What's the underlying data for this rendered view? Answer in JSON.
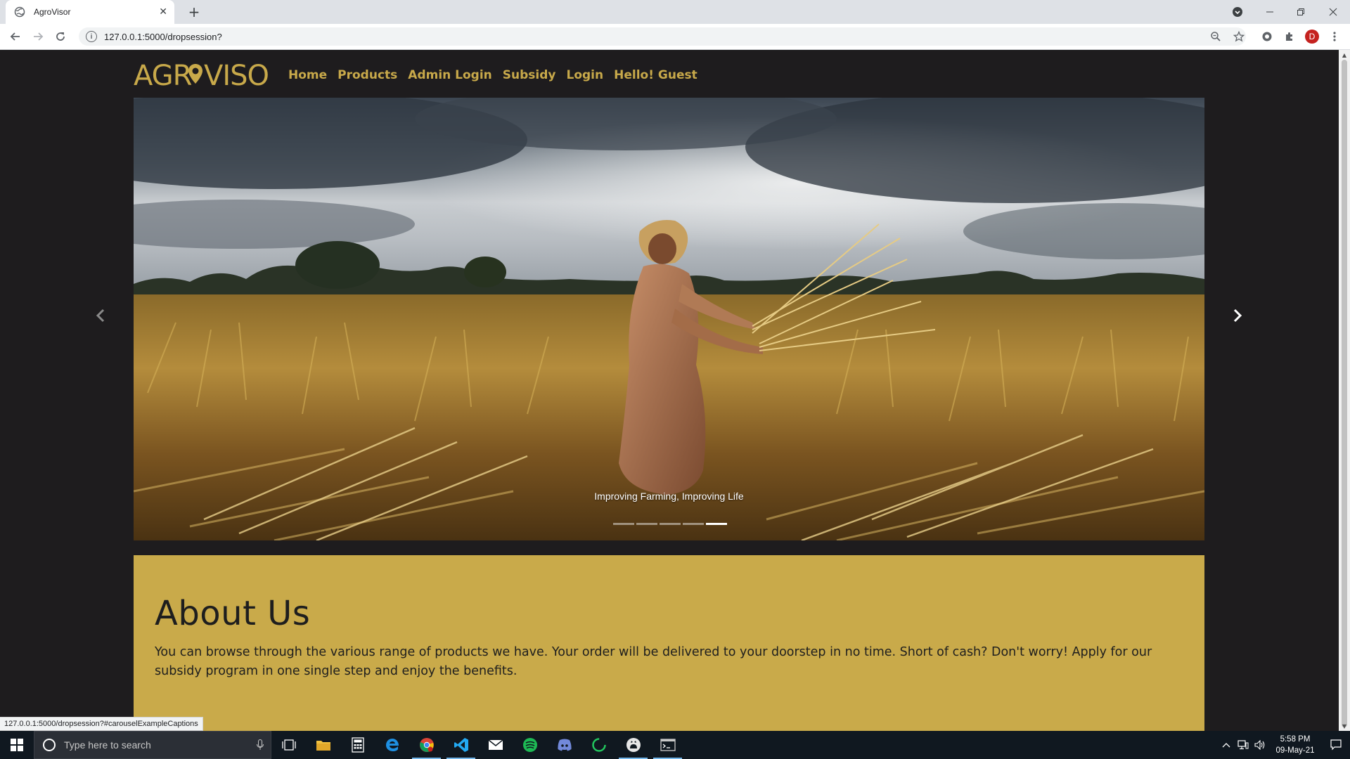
{
  "browser": {
    "tab_title": "AgroVisor",
    "tab_close": "✕",
    "new_tab": "+",
    "url": "127.0.0.1:5000/dropsession?",
    "avatar_letter": "D",
    "status_url": "127.0.0.1:5000/dropsession?#carouselExampleCaptions"
  },
  "site": {
    "logo_text": "AGROVISOR",
    "nav": [
      "Home",
      "Products",
      "Admin Login",
      "Subsidy",
      "Login",
      "Hello! Guest"
    ]
  },
  "carousel": {
    "caption": "Improving Farming, Improving Life",
    "slide_count": 5,
    "active_slide": 5,
    "image_subject": "woman harvesting wheat in a field under a cloudy sky"
  },
  "about": {
    "title": "About Us",
    "text": "You can browse through the various range of products we have. Your order will be delivered to your doorstep in no time. Short of cash? Don't worry! Apply for our subsidy program in one single step and enjoy the benefits."
  },
  "taskbar": {
    "search_placeholder": "Type here to search",
    "time": "5:58 PM",
    "date": "09-May-21",
    "apps": [
      "task-view",
      "file-explorer",
      "calculator",
      "edge",
      "chrome",
      "vscode",
      "mail",
      "spotify-like",
      "discord",
      "loader-app",
      "github-desktop",
      "terminal"
    ]
  },
  "colors": {
    "page_bg": "#1e1c1e",
    "accent_gold": "#c8a94a",
    "about_bg": "#c9aa4a"
  }
}
